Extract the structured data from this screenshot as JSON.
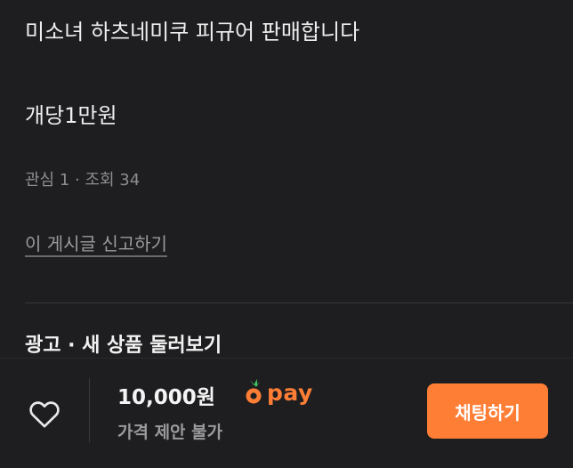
{
  "post": {
    "description_lines": [
      "미소녀 하츠네미쿠 피규어 판매합니다",
      "개당1만원"
    ],
    "stats": "관심 1 · 조회 34",
    "report_link": "이 게시글 신고하기"
  },
  "ads_section": {
    "title": "광고 · 새 상품 둘러보기"
  },
  "bottom_bar": {
    "price": "10,000원",
    "pay_label": "pay",
    "price_note": "가격 제안 불가",
    "chat_button": "채팅하기",
    "like_icon": "heart-outline-icon",
    "pay_icon": "carrot-pay-icon",
    "accent_color": "#ff7e36"
  }
}
